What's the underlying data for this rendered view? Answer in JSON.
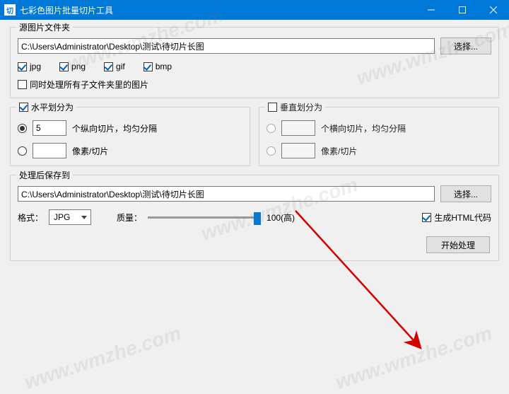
{
  "window": {
    "icon_char": "切",
    "title": "七彩色图片批量切片工具"
  },
  "source": {
    "group_label": "源图片文件夹",
    "path": "C:\\Users\\Administrator\\Desktop\\测试\\待切片长图",
    "select_btn": "选择...",
    "fmt_jpg": "jpg",
    "fmt_png": "png",
    "fmt_gif": "gif",
    "fmt_bmp": "bmp",
    "subfolder_label": "同时处理所有子文件夹里的图片"
  },
  "hsplit": {
    "group_label": "水平划分为",
    "count_value": "5",
    "count_label": "个纵向切片，均匀分隔",
    "pixel_label": "像素/切片"
  },
  "vsplit": {
    "group_label": "垂直划分为",
    "count_label": "个横向切片，均匀分隔",
    "pixel_label": "像素/切片"
  },
  "output": {
    "group_label": "处理后保存到",
    "path": "C:\\Users\\Administrator\\Desktop\\测试\\待切片长图",
    "select_btn": "选择...",
    "format_label": "格式：",
    "format_value": "JPG",
    "quality_label": "质量：",
    "quality_value": "100(高)",
    "gen_html_label": "生成HTML代码"
  },
  "start_btn": "开始处理",
  "watermark": "www.wmzhe.com"
}
